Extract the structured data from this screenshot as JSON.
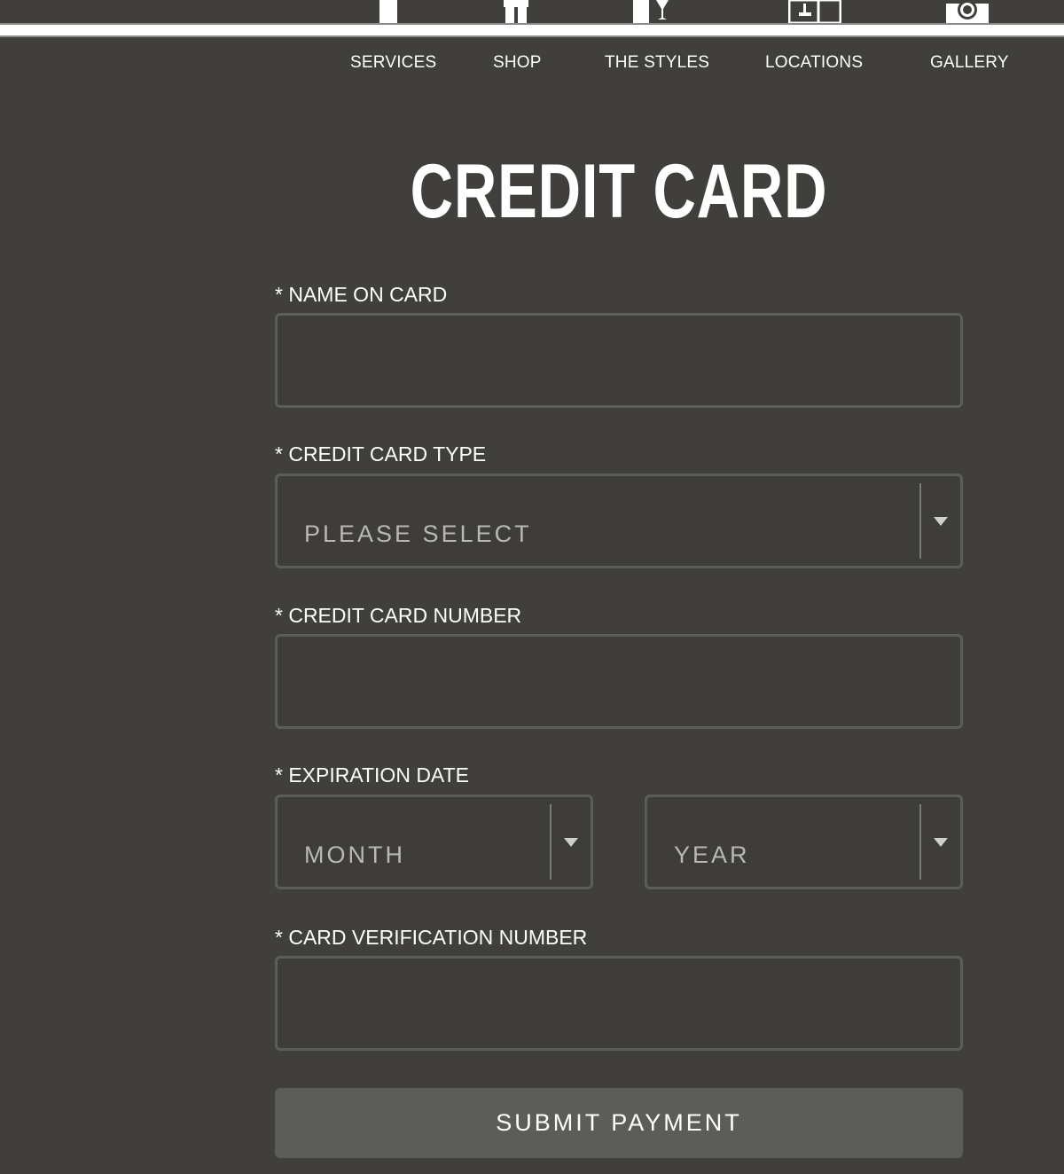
{
  "nav": {
    "items": [
      {
        "label": "SERVICES"
      },
      {
        "label": "SHOP"
      },
      {
        "label": "THE STYLES"
      },
      {
        "label": "LOCATIONS"
      },
      {
        "label": "GALLERY"
      }
    ]
  },
  "page": {
    "title": "CREDIT CARD"
  },
  "form": {
    "name_on_card": {
      "label": "* NAME ON CARD",
      "value": ""
    },
    "card_type": {
      "label": "* CREDIT CARD TYPE",
      "value": "PLEASE SELECT"
    },
    "card_number": {
      "label": "* CREDIT CARD NUMBER",
      "value": ""
    },
    "expiration": {
      "label": "* EXPIRATION DATE",
      "month": "MONTH",
      "year": "YEAR"
    },
    "cvv": {
      "label": "* CARD VERIFICATION NUMBER",
      "value": ""
    },
    "submit_label": "SUBMIT PAYMENT"
  },
  "icons": {
    "skyline": [
      "building-icon",
      "gift-icon",
      "cocktail-glass-icon",
      "storefront-icon",
      "camera-icon"
    ]
  },
  "colors": {
    "background": "#403f3b",
    "field_border": "#5c5c58",
    "button": "#5c5d59",
    "text": "#ffffff",
    "placeholder": "#b9b8b2"
  }
}
